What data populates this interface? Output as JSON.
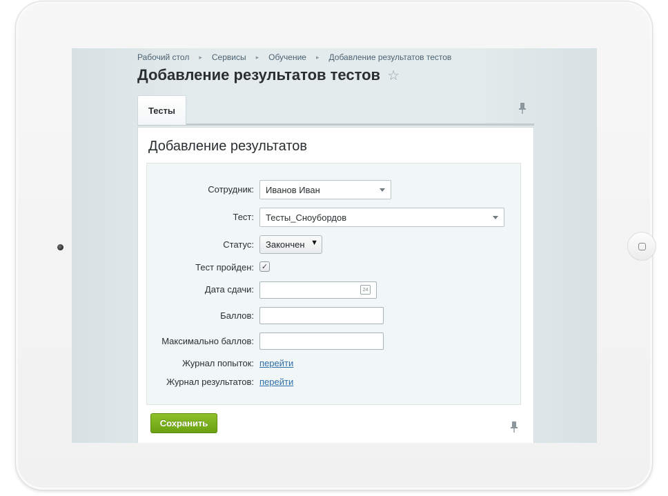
{
  "breadcrumb": {
    "items": [
      "Рабочий стол",
      "Сервисы",
      "Обучение",
      "Добавление результатов тестов"
    ]
  },
  "page": {
    "title": "Добавление результатов тестов"
  },
  "tabs": [
    {
      "label": "Тесты",
      "active": true
    }
  ],
  "section": {
    "title": "Добавление результатов"
  },
  "form": {
    "employee": {
      "label": "Сотрудник:",
      "value": "Иванов Иван"
    },
    "test": {
      "label": "Тест:",
      "value": "Тесты_Сноубордов"
    },
    "status": {
      "label": "Статус:",
      "value": "Закончен"
    },
    "passed": {
      "label": "Тест пройден:",
      "checked": true
    },
    "date": {
      "label": "Дата сдачи:",
      "value": "",
      "calendar_day": "24"
    },
    "score": {
      "label": "Баллов:",
      "value": ""
    },
    "max_score": {
      "label": "Максимально баллов:",
      "value": ""
    },
    "attempts_log": {
      "label": "Журнал попыток:",
      "link": "перейти"
    },
    "results_log": {
      "label": "Журнал результатов:",
      "link": "перейти"
    }
  },
  "actions": {
    "save_label": "Сохранить"
  },
  "colors": {
    "accent_button": "#7ab11d",
    "link": "#2e6ea9",
    "screen_background": "#e0e7e9"
  },
  "icons": {
    "favorite": "star-outline-icon",
    "pin": "pin-icon",
    "calendar": "calendar-icon",
    "home": "home-button-icon"
  }
}
